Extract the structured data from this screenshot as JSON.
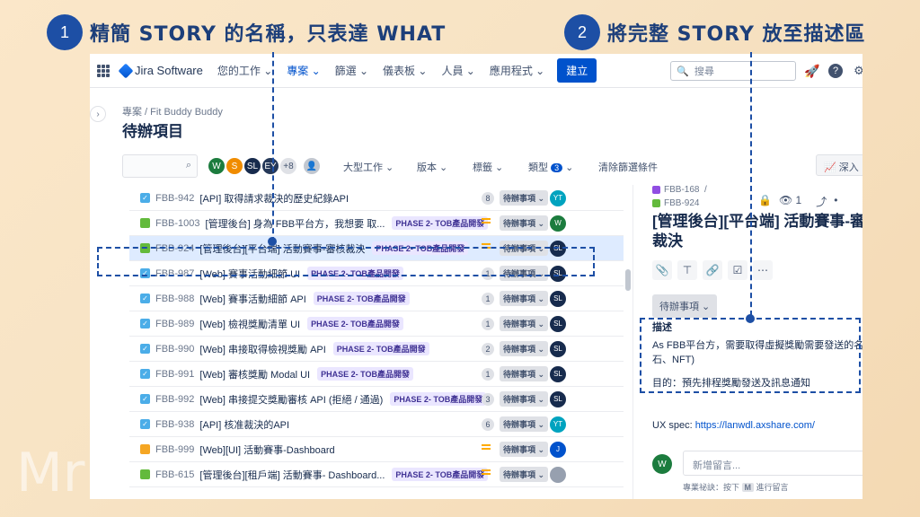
{
  "slide": {
    "step1_number": "1",
    "step1_text": "精簡 STORY 的名稱，只表達 WHAT",
    "step2_number": "2",
    "step2_text": "將完整 STORY 放至描述區",
    "watermark": "Mr"
  },
  "topnav": {
    "logo": "Jira Software",
    "items": [
      "您的工作 ⌄",
      "專案 ⌄",
      "篩選 ⌄",
      "儀表板 ⌄",
      "人員 ⌄",
      "應用程式 ⌄"
    ],
    "create": "建立",
    "search_placeholder": "搜尋"
  },
  "breadcrumb": "專案  /  Fit Buddy Buddy",
  "page_title": "待辦項目",
  "filters": {
    "more_count": "+8",
    "epic": "大型工作 ⌄",
    "version": "版本 ⌄",
    "label": "標籤 ⌄",
    "type": "類型",
    "type_count": "3",
    "clear": "清除篩選條件",
    "insights": "深入"
  },
  "avatars": [
    {
      "initials": "W",
      "color": "#1c7c3e"
    },
    {
      "initials": "S",
      "color": "#f08c00"
    },
    {
      "initials": "SL",
      "color": "#172b4d"
    },
    {
      "initials": "EY",
      "color": "#253858"
    }
  ],
  "rows": [
    {
      "type": "task",
      "key": "FBB-942",
      "summary": "[API] 取得請求裁決的歷史紀錄API",
      "epic": "",
      "points": "8",
      "prio": false,
      "status": "待辦事項 ⌄",
      "assignee": "YT",
      "assignee_color": "#00a3bf"
    },
    {
      "type": "story",
      "key": "FBB-1003",
      "summary": "[管理後台] 身為 FBB平台方，我想要 取...",
      "epic": "PHASE 2- TOB產品開發",
      "points": "",
      "prio": true,
      "status": "待辦事項 ⌄",
      "assignee": "W",
      "assignee_color": "#1c7c3e"
    },
    {
      "type": "story",
      "key": "FBB-924",
      "summary": "[管理後台][平台端] 活動賽事-審核裁決",
      "epic": "PHASE 2- TOB產品開發",
      "points": "",
      "prio": true,
      "status": "待辦事項 ⌄",
      "assignee": "SL",
      "assignee_color": "#172b4d"
    },
    {
      "type": "task",
      "key": "FBB-987",
      "summary": "[Web] 賽事活動細節 UI",
      "epic": "PHASE 2- TOB產品開發",
      "points": "1",
      "prio": false,
      "status": "待辦事項 ⌄",
      "assignee": "SL",
      "assignee_color": "#172b4d"
    },
    {
      "type": "task",
      "key": "FBB-988",
      "summary": "[Web] 賽事活動細節 API",
      "epic": "PHASE 2- TOB產品開發",
      "points": "1",
      "prio": false,
      "status": "待辦事項 ⌄",
      "assignee": "SL",
      "assignee_color": "#172b4d"
    },
    {
      "type": "task",
      "key": "FBB-989",
      "summary": "[Web] 檢視獎勵清單 UI",
      "epic": "PHASE 2- TOB產品開發",
      "points": "1",
      "prio": false,
      "status": "待辦事項 ⌄",
      "assignee": "SL",
      "assignee_color": "#172b4d"
    },
    {
      "type": "task",
      "key": "FBB-990",
      "summary": "[Web] 串接取得檢視獎勵 API",
      "epic": "PHASE 2- TOB產品開發",
      "points": "2",
      "prio": false,
      "status": "待辦事項 ⌄",
      "assignee": "SL",
      "assignee_color": "#172b4d"
    },
    {
      "type": "task",
      "key": "FBB-991",
      "summary": "[Web] 審核獎勵 Modal UI",
      "epic": "PHASE 2- TOB產品開發",
      "points": "1",
      "prio": false,
      "status": "待辦事項 ⌄",
      "assignee": "SL",
      "assignee_color": "#172b4d"
    },
    {
      "type": "task",
      "key": "FBB-992",
      "summary": "[Web] 串接提交獎勵審核 API (拒絕 / 通過)",
      "epic": "PHASE 2- TOB產品開發",
      "points": "3",
      "prio": false,
      "status": "待辦事項 ⌄",
      "assignee": "SL",
      "assignee_color": "#172b4d"
    },
    {
      "type": "task",
      "key": "FBB-938",
      "summary": "[API] 核准裁決的API",
      "epic": "",
      "points": "6",
      "prio": false,
      "status": "待辦事項 ⌄",
      "assignee": "YT",
      "assignee_color": "#00a3bf"
    },
    {
      "type": "sub",
      "key": "FBB-999",
      "summary": "[Web][UI] 活動賽事-Dashboard",
      "epic": "",
      "points": "",
      "prio": true,
      "status": "待辦事項 ⌄",
      "assignee": "J",
      "assignee_color": "#0052cc"
    },
    {
      "type": "story",
      "key": "FBB-615",
      "summary": "[管理後台][租戶端] 活動賽事- Dashboard...",
      "epic": "PHASE 2- TOB產品開發",
      "points": "",
      "prio": true,
      "status": "待辦事項 ⌄",
      "assignee": "",
      "assignee_color": "#97a0af"
    }
  ],
  "detail": {
    "parent1": "FBB-168",
    "parent1_sep": "/",
    "parent2": "FBB-924",
    "watch_count": "1",
    "title_line1": "[管理後台][平台端] 活動賽事-審",
    "title_line2": "裁決",
    "status": "待辦事項 ⌄",
    "desc_label": "描述",
    "desc_line1": "As FBB平台方，需要取得虛擬獎勵需要發送的名單 (e",
    "desc_line2": "石、NFT)",
    "desc_line3": "目的：預先排程獎勵發送及訊息通知",
    "uxspec_label": "UX spec: ",
    "uxspec_link": "https://lanwdl.axshare.com/",
    "comment_avatar": "W",
    "comment_placeholder": "新增留言...",
    "tip_prefix": "專業祕訣：按下",
    "tip_key": "M",
    "tip_suffix": "進行留言"
  }
}
